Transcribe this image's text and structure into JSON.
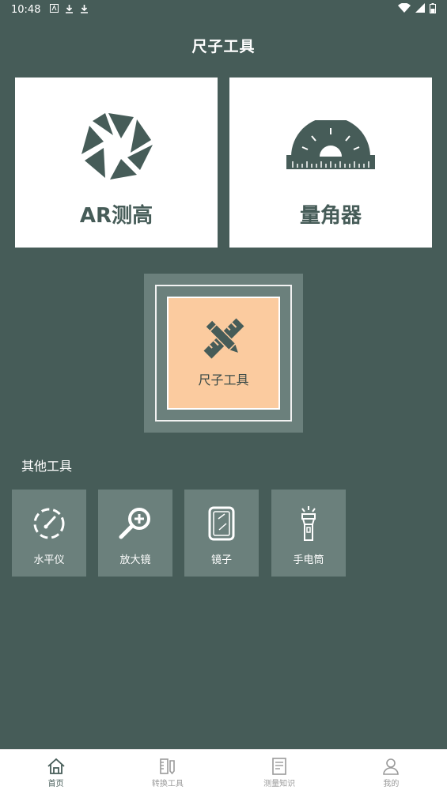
{
  "status_bar": {
    "time": "10:48",
    "icons": [
      "app-a-icon",
      "download-icon",
      "download-icon"
    ],
    "right_icons": [
      "wifi-icon",
      "signal-icon",
      "battery-icon"
    ]
  },
  "header": {
    "title": "尺子工具"
  },
  "cards": {
    "ar_height": {
      "label": "AR测高",
      "icon": "camera-aperture-icon"
    },
    "protractor": {
      "label": "量角器",
      "icon": "protractor-icon"
    }
  },
  "featured": {
    "label": "尺子工具",
    "icon": "ruler-pencil-icon"
  },
  "other_tools": {
    "title": "其他工具",
    "items": [
      {
        "label": "水平仪",
        "icon": "level-gauge-icon"
      },
      {
        "label": "放大镜",
        "icon": "magnifier-icon"
      },
      {
        "label": "镜子",
        "icon": "mirror-icon"
      },
      {
        "label": "手电筒",
        "icon": "flashlight-icon"
      }
    ]
  },
  "bottom_nav": {
    "items": [
      {
        "label": "首页",
        "icon": "home-icon",
        "active": true
      },
      {
        "label": "转换工具",
        "icon": "convert-tool-icon"
      },
      {
        "label": "测量知识",
        "icon": "document-icon"
      },
      {
        "label": "我的",
        "icon": "user-icon"
      }
    ]
  },
  "colors": {
    "background": "#465c58",
    "tile": "#6b807c",
    "accent": "#fbcb9f",
    "card": "#ffffff"
  }
}
